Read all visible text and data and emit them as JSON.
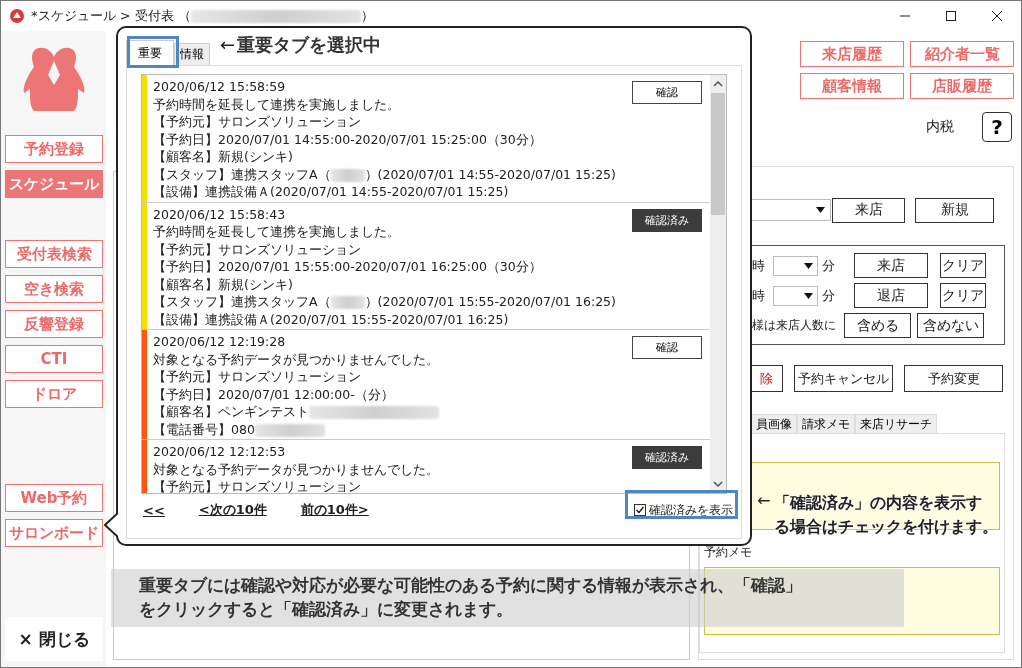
{
  "window": {
    "title": {
      "text": "*スケジュール > 受付表 （",
      "redacted": true,
      "after": "）"
    }
  },
  "sidebar": {
    "groups": [
      [
        {
          "label": "予約登録",
          "selected": false
        },
        {
          "label": "スケジュール",
          "selected": true
        }
      ],
      [
        {
          "label": "受付表検索",
          "selected": false
        },
        {
          "label": "空き検索",
          "selected": false
        },
        {
          "label": "反響登録",
          "selected": false
        },
        {
          "label": "CTI",
          "selected": false
        },
        {
          "label": "ドロア",
          "selected": false
        }
      ],
      [
        {
          "label": "Web予約",
          "selected": false
        },
        {
          "label": "サロンボード",
          "selected": false
        }
      ]
    ],
    "close": {
      "icon": "×",
      "label": "閉じる"
    }
  },
  "header_buttons": [
    "来店履歴",
    "紹介者一覧",
    "顧客情報",
    "店販履歴"
  ],
  "tax_label": "内税",
  "help_button": "?",
  "reception": {
    "visit_button": "来店",
    "new_button": "新規"
  },
  "time_rows": [
    {
      "hour_label": "時",
      "minute_label": "分",
      "action": "来店",
      "clear": "クリア"
    },
    {
      "hour_label": "時",
      "minute_label": "分",
      "action": "退店",
      "clear": "クリア"
    }
  ],
  "headcount": {
    "label": "様は来店人数に",
    "include": "含める",
    "exclude": "含めない"
  },
  "actions": [
    {
      "label": "除",
      "danger": true
    },
    {
      "label": "予約キャンセル",
      "danger": false
    },
    {
      "label": "予約変更",
      "danger": false
    }
  ],
  "detail_tabs": [
    "員画像",
    "請求メモ",
    "来店リサーチ"
  ],
  "memo_label": "予約メモ",
  "popup": {
    "tabs": [
      {
        "label": "重要",
        "selected": true
      },
      {
        "label": "情報",
        "selected": false
      }
    ],
    "notices": [
      {
        "color": "#f2e200",
        "timestamp": "2020/06/12 15:58:59",
        "button": "確認",
        "confirmed": false,
        "lines": [
          {
            "text": "予約時間を延長して連携を実施しました。"
          },
          {
            "text": "【予約元】サロンズソリューション"
          },
          {
            "text": "【予約日】2020/07/01 14:55:00-2020/07/01 15:25:00（30分）"
          },
          {
            "text": "【顧客名】新規(シンキ)"
          },
          {
            "text": "【スタッフ】連携スタッフA（",
            "redacted": true,
            "after": "）(2020/07/01 14:55-2020/07/01 15:25)"
          },
          {
            "text": "【設備】連携設備Ａ(2020/07/01 14:55-2020/07/01 15:25)"
          }
        ]
      },
      {
        "color": "#f2e200",
        "timestamp": "2020/06/12 15:58:43",
        "button": "確認済み",
        "confirmed": true,
        "lines": [
          {
            "text": "予約時間を延長して連携を実施しました。"
          },
          {
            "text": "【予約元】サロンズソリューション"
          },
          {
            "text": "【予約日】2020/07/01 15:55:00-2020/07/01 16:25:00（30分）"
          },
          {
            "text": "【顧客名】新規(シンキ)"
          },
          {
            "text": "【スタッフ】連携スタッフA（",
            "redacted": true,
            "after": "）(2020/07/01 15:55-2020/07/01 16:25)"
          },
          {
            "text": "【設備】連携設備Ａ(2020/07/01 15:55-2020/07/01 16:25)"
          }
        ]
      },
      {
        "color": "#ff5512",
        "timestamp": "2020/06/12 12:19:28",
        "button": "確認",
        "confirmed": false,
        "lines": [
          {
            "text": "対象となる予約データが見つかりませんでした。"
          },
          {
            "text": "【予約元】サロンズソリューション"
          },
          {
            "text": "【予約日】2020/07/01 12:00:00-（分）"
          },
          {
            "text": "【顧客名】ペンギンテスト",
            "redacted": true
          },
          {
            "text": "【電話番号】080",
            "redacted": true
          }
        ]
      },
      {
        "color": "#ff5512",
        "timestamp": "2020/06/12 12:12:53",
        "button": "確認済み",
        "confirmed": true,
        "lines": [
          {
            "text": "対象となる予約データが見つかりませんでした。"
          },
          {
            "text": "【予約元】サロンズソリューション"
          }
        ]
      }
    ],
    "nav_links": [
      "<<",
      "<次の10件",
      "前の10件>"
    ],
    "show_confirmed": {
      "label": "確認済みを表示",
      "checked": true
    }
  },
  "annotations": {
    "tab_note": {
      "arrow": "←",
      "text": "重要タブを選択中"
    },
    "checkbox_note": {
      "arrow": "←",
      "lines": [
        "「確認済み」の内容を表示す",
        "る場合はチェックを付けます。"
      ]
    },
    "summary": [
      "重要タブには確認や対応が必要な可能性のある予約に関する情報が表示され、「確認」",
      "をクリックすると「確認済み」に変更されます。"
    ]
  }
}
